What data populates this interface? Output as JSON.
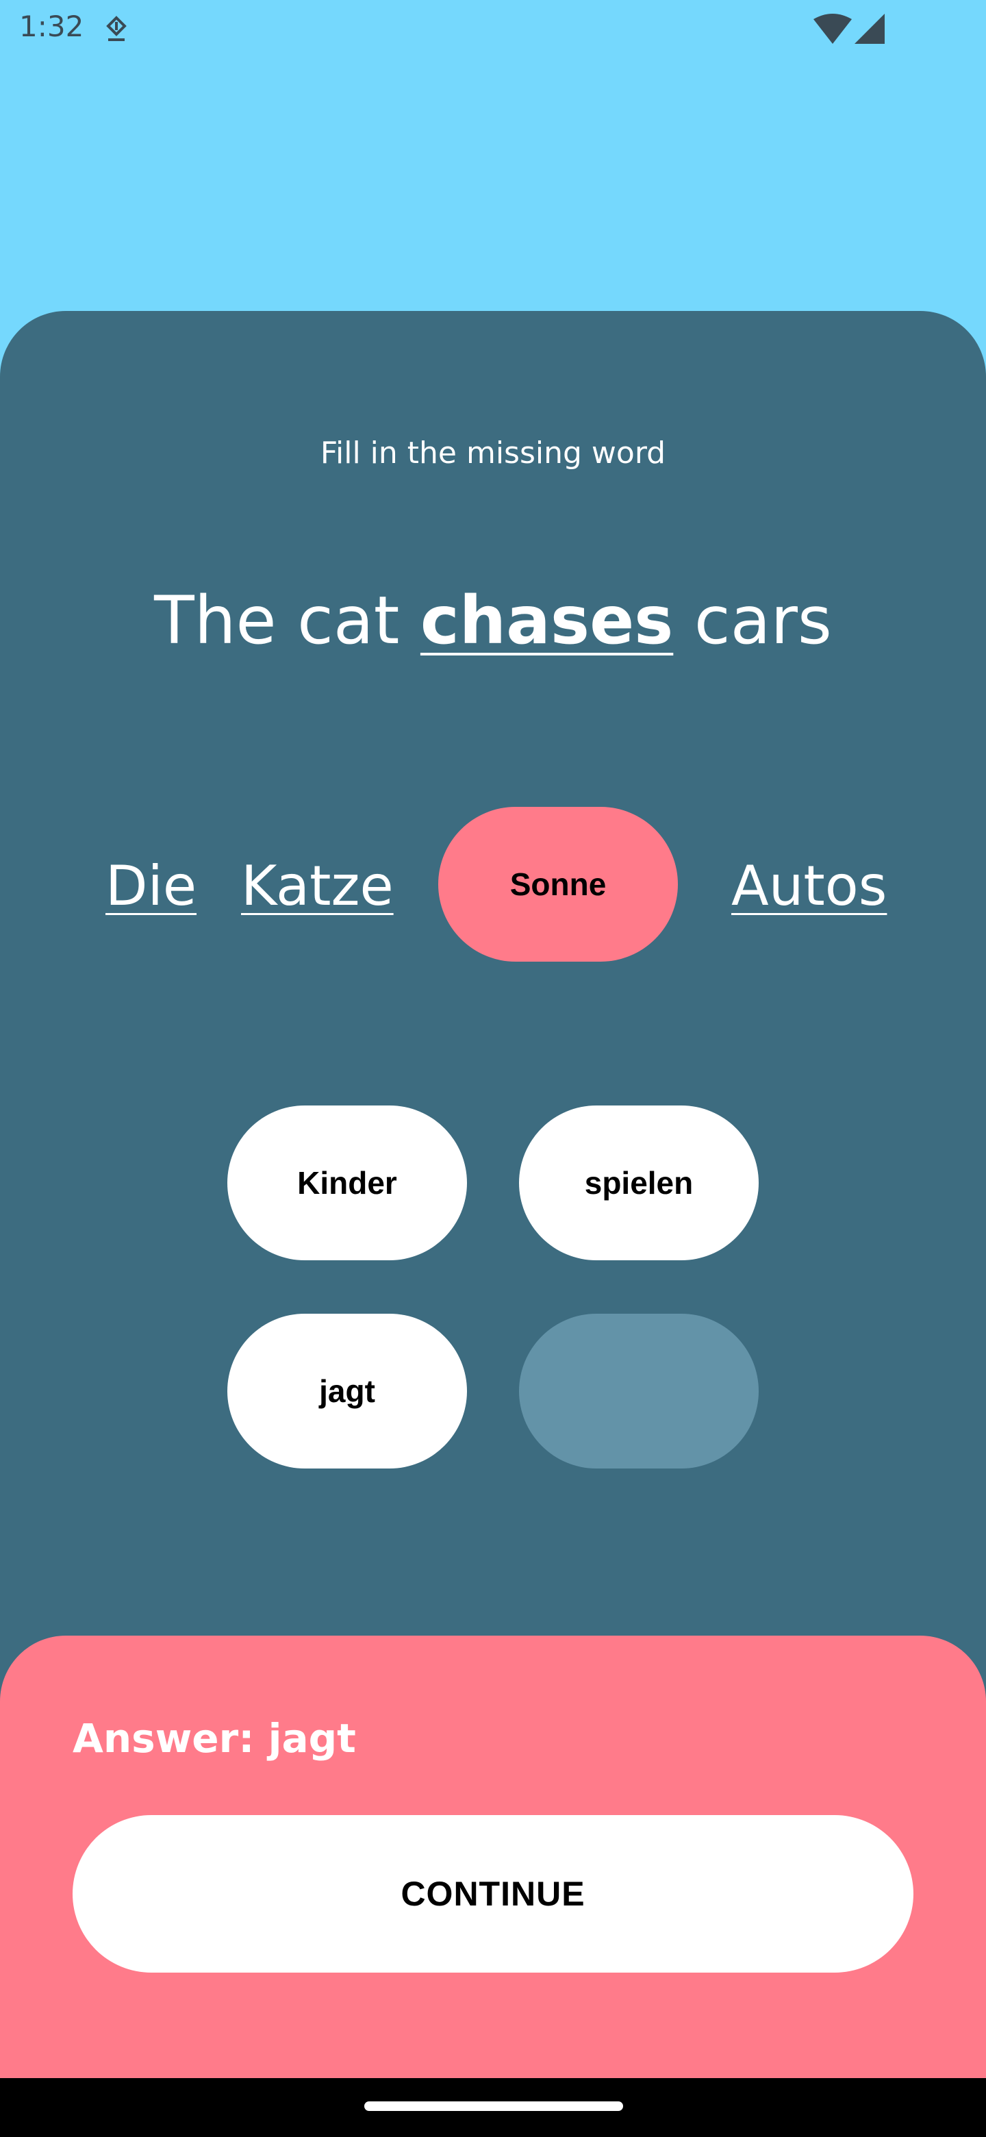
{
  "status_bar": {
    "time": "1:32",
    "icons": [
      "download-icon",
      "wifi-icon",
      "signal-icon"
    ]
  },
  "exercise": {
    "instruction": "Fill in the missing word",
    "sentence": {
      "before": "The cat ",
      "highlight": "chases",
      "after": " cars"
    },
    "target_words": {
      "w1": "Die",
      "w2": "Katze",
      "slot": "Sonne",
      "w4": "Autos"
    },
    "options": {
      "kinder": "Kinder",
      "spielen": "spielen",
      "jagt": "jagt",
      "empty": ""
    }
  },
  "feedback": {
    "answer": "Answer: jagt",
    "continue_label": "CONTINUE"
  },
  "colors": {
    "sky": "#75d8fd",
    "card": "#3d6c80",
    "accent": "#ff7b8a",
    "empty_slot": "#6393a8"
  }
}
